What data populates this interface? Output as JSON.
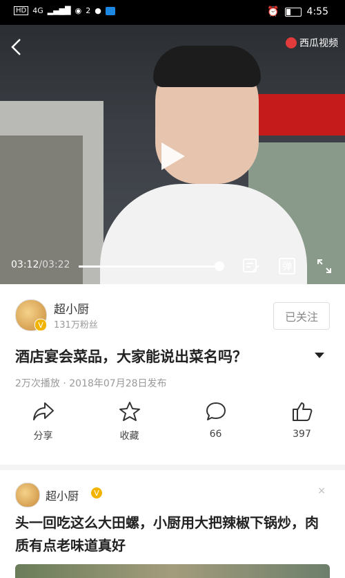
{
  "statusbar": {
    "network": "4G",
    "signal_sub": "4G",
    "wifi_badge": "2",
    "time": "4:55"
  },
  "video": {
    "watermark": "西瓜视频",
    "current_time": "03:12",
    "separator": "/",
    "total_time": "03:22",
    "progress": 0.97,
    "danmaku_label": "弹"
  },
  "author": {
    "name": "超小厨",
    "fans": "131万粉丝",
    "follow_label": "已关注"
  },
  "post": {
    "title": "酒店宴会菜品，大家能说出菜名吗？",
    "meta": "2万次播放 · 2018年07月28日发布"
  },
  "actions": [
    {
      "icon": "share-icon",
      "label": "分享"
    },
    {
      "icon": "star-icon",
      "label": "收藏"
    },
    {
      "icon": "comment-icon",
      "label": "66"
    },
    {
      "icon": "thumbs-up-icon",
      "label": "397"
    }
  ],
  "recommend": {
    "author_name": "超小厨",
    "title": "头一回吃这么大田螺，小厨用大把辣椒下锅炒，肉质有点老味道真好",
    "close": "×"
  }
}
